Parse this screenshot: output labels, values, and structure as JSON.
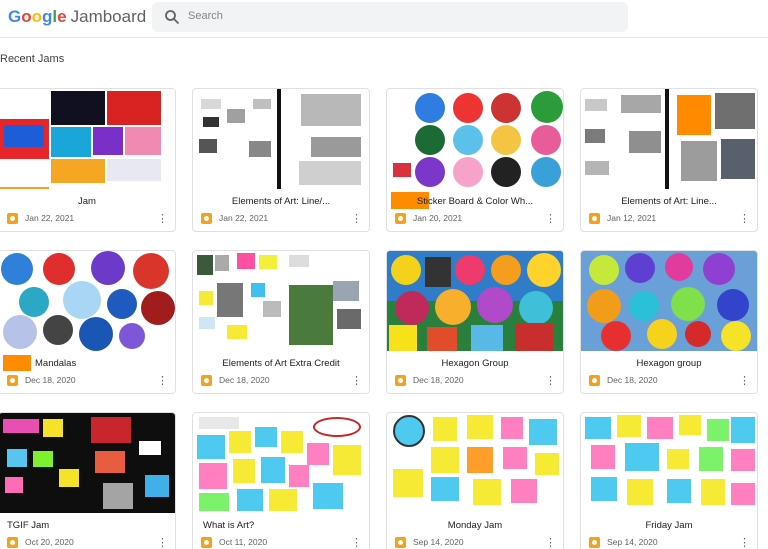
{
  "app": {
    "logo_google": "Google",
    "logo_name": "Jamboard",
    "brand_colors": [
      "#4285f4",
      "#ea4335",
      "#fbbc05",
      "#4285f4",
      "#34a853",
      "#ea4335"
    ]
  },
  "search": {
    "placeholder": "Search",
    "icon": "search-icon"
  },
  "section_title": "Recent Jams",
  "cards": [
    {
      "name": "Jam",
      "date": "Jan 22, 2021"
    },
    {
      "name": "Elements of Art: Line/...",
      "date": "Jan 22, 2021"
    },
    {
      "name": "Sticker Board & Color Wh...",
      "date": "Jan 20, 2021"
    },
    {
      "name": "Elements of Art: Line...",
      "date": "Jan 12, 2021"
    },
    {
      "name": "Mandalas",
      "date": "Dec 18, 2020"
    },
    {
      "name": "Elements of Art Extra Credit",
      "date": "Dec 18, 2020"
    },
    {
      "name": "Hexagon Group",
      "date": "Dec 18, 2020"
    },
    {
      "name": "Hexagon group",
      "date": "Dec 18, 2020"
    },
    {
      "name": "TGIF Jam",
      "date": "Oct 20, 2020"
    },
    {
      "name": "What is Art?",
      "date": "Oct 11, 2020"
    },
    {
      "name": "Monday Jam",
      "date": "Sep 14, 2020"
    },
    {
      "name": "Friday Jam",
      "date": "Sep 14, 2020"
    }
  ],
  "more_icon": "more-vert-icon",
  "jam_icon": "jamboard-icon",
  "accent_color": "#f4a21d",
  "redaction_color": "#ff8c00"
}
